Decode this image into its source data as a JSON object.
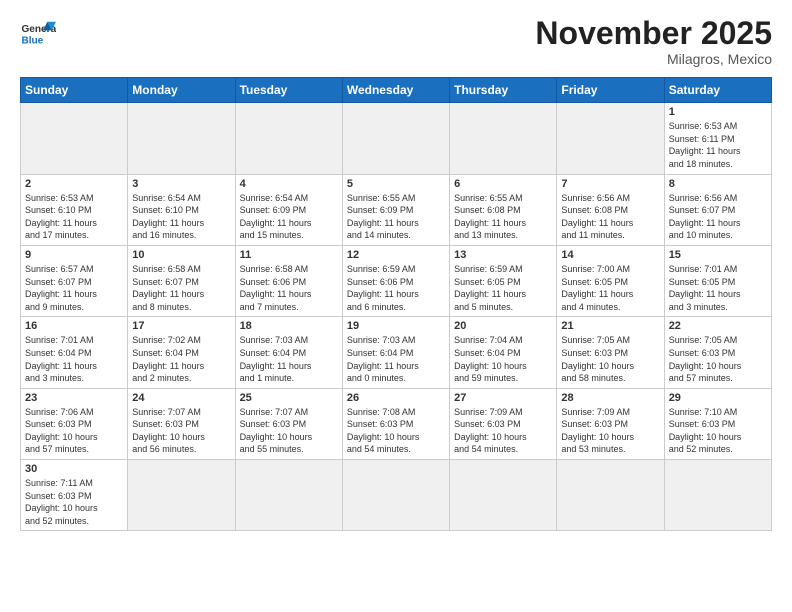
{
  "header": {
    "logo_general": "General",
    "logo_blue": "Blue",
    "month_title": "November 2025",
    "location": "Milagros, Mexico"
  },
  "days_of_week": [
    "Sunday",
    "Monday",
    "Tuesday",
    "Wednesday",
    "Thursday",
    "Friday",
    "Saturday"
  ],
  "weeks": [
    [
      {
        "day": "",
        "info": ""
      },
      {
        "day": "",
        "info": ""
      },
      {
        "day": "",
        "info": ""
      },
      {
        "day": "",
        "info": ""
      },
      {
        "day": "",
        "info": ""
      },
      {
        "day": "",
        "info": ""
      },
      {
        "day": "1",
        "info": "Sunrise: 6:53 AM\nSunset: 6:11 PM\nDaylight: 11 hours\nand 18 minutes."
      }
    ],
    [
      {
        "day": "2",
        "info": "Sunrise: 6:53 AM\nSunset: 6:10 PM\nDaylight: 11 hours\nand 17 minutes."
      },
      {
        "day": "3",
        "info": "Sunrise: 6:54 AM\nSunset: 6:10 PM\nDaylight: 11 hours\nand 16 minutes."
      },
      {
        "day": "4",
        "info": "Sunrise: 6:54 AM\nSunset: 6:09 PM\nDaylight: 11 hours\nand 15 minutes."
      },
      {
        "day": "5",
        "info": "Sunrise: 6:55 AM\nSunset: 6:09 PM\nDaylight: 11 hours\nand 14 minutes."
      },
      {
        "day": "6",
        "info": "Sunrise: 6:55 AM\nSunset: 6:08 PM\nDaylight: 11 hours\nand 13 minutes."
      },
      {
        "day": "7",
        "info": "Sunrise: 6:56 AM\nSunset: 6:08 PM\nDaylight: 11 hours\nand 11 minutes."
      },
      {
        "day": "8",
        "info": "Sunrise: 6:56 AM\nSunset: 6:07 PM\nDaylight: 11 hours\nand 10 minutes."
      }
    ],
    [
      {
        "day": "9",
        "info": "Sunrise: 6:57 AM\nSunset: 6:07 PM\nDaylight: 11 hours\nand 9 minutes."
      },
      {
        "day": "10",
        "info": "Sunrise: 6:58 AM\nSunset: 6:07 PM\nDaylight: 11 hours\nand 8 minutes."
      },
      {
        "day": "11",
        "info": "Sunrise: 6:58 AM\nSunset: 6:06 PM\nDaylight: 11 hours\nand 7 minutes."
      },
      {
        "day": "12",
        "info": "Sunrise: 6:59 AM\nSunset: 6:06 PM\nDaylight: 11 hours\nand 6 minutes."
      },
      {
        "day": "13",
        "info": "Sunrise: 6:59 AM\nSunset: 6:05 PM\nDaylight: 11 hours\nand 5 minutes."
      },
      {
        "day": "14",
        "info": "Sunrise: 7:00 AM\nSunset: 6:05 PM\nDaylight: 11 hours\nand 4 minutes."
      },
      {
        "day": "15",
        "info": "Sunrise: 7:01 AM\nSunset: 6:05 PM\nDaylight: 11 hours\nand 3 minutes."
      }
    ],
    [
      {
        "day": "16",
        "info": "Sunrise: 7:01 AM\nSunset: 6:04 PM\nDaylight: 11 hours\nand 3 minutes."
      },
      {
        "day": "17",
        "info": "Sunrise: 7:02 AM\nSunset: 6:04 PM\nDaylight: 11 hours\nand 2 minutes."
      },
      {
        "day": "18",
        "info": "Sunrise: 7:03 AM\nSunset: 6:04 PM\nDaylight: 11 hours\nand 1 minute."
      },
      {
        "day": "19",
        "info": "Sunrise: 7:03 AM\nSunset: 6:04 PM\nDaylight: 11 hours\nand 0 minutes."
      },
      {
        "day": "20",
        "info": "Sunrise: 7:04 AM\nSunset: 6:04 PM\nDaylight: 10 hours\nand 59 minutes."
      },
      {
        "day": "21",
        "info": "Sunrise: 7:05 AM\nSunset: 6:03 PM\nDaylight: 10 hours\nand 58 minutes."
      },
      {
        "day": "22",
        "info": "Sunrise: 7:05 AM\nSunset: 6:03 PM\nDaylight: 10 hours\nand 57 minutes."
      }
    ],
    [
      {
        "day": "23",
        "info": "Sunrise: 7:06 AM\nSunset: 6:03 PM\nDaylight: 10 hours\nand 57 minutes."
      },
      {
        "day": "24",
        "info": "Sunrise: 7:07 AM\nSunset: 6:03 PM\nDaylight: 10 hours\nand 56 minutes."
      },
      {
        "day": "25",
        "info": "Sunrise: 7:07 AM\nSunset: 6:03 PM\nDaylight: 10 hours\nand 55 minutes."
      },
      {
        "day": "26",
        "info": "Sunrise: 7:08 AM\nSunset: 6:03 PM\nDaylight: 10 hours\nand 54 minutes."
      },
      {
        "day": "27",
        "info": "Sunrise: 7:09 AM\nSunset: 6:03 PM\nDaylight: 10 hours\nand 54 minutes."
      },
      {
        "day": "28",
        "info": "Sunrise: 7:09 AM\nSunset: 6:03 PM\nDaylight: 10 hours\nand 53 minutes."
      },
      {
        "day": "29",
        "info": "Sunrise: 7:10 AM\nSunset: 6:03 PM\nDaylight: 10 hours\nand 52 minutes."
      }
    ],
    [
      {
        "day": "30",
        "info": "Sunrise: 7:11 AM\nSunset: 6:03 PM\nDaylight: 10 hours\nand 52 minutes."
      },
      {
        "day": "",
        "info": ""
      },
      {
        "day": "",
        "info": ""
      },
      {
        "day": "",
        "info": ""
      },
      {
        "day": "",
        "info": ""
      },
      {
        "day": "",
        "info": ""
      },
      {
        "day": "",
        "info": ""
      }
    ]
  ]
}
